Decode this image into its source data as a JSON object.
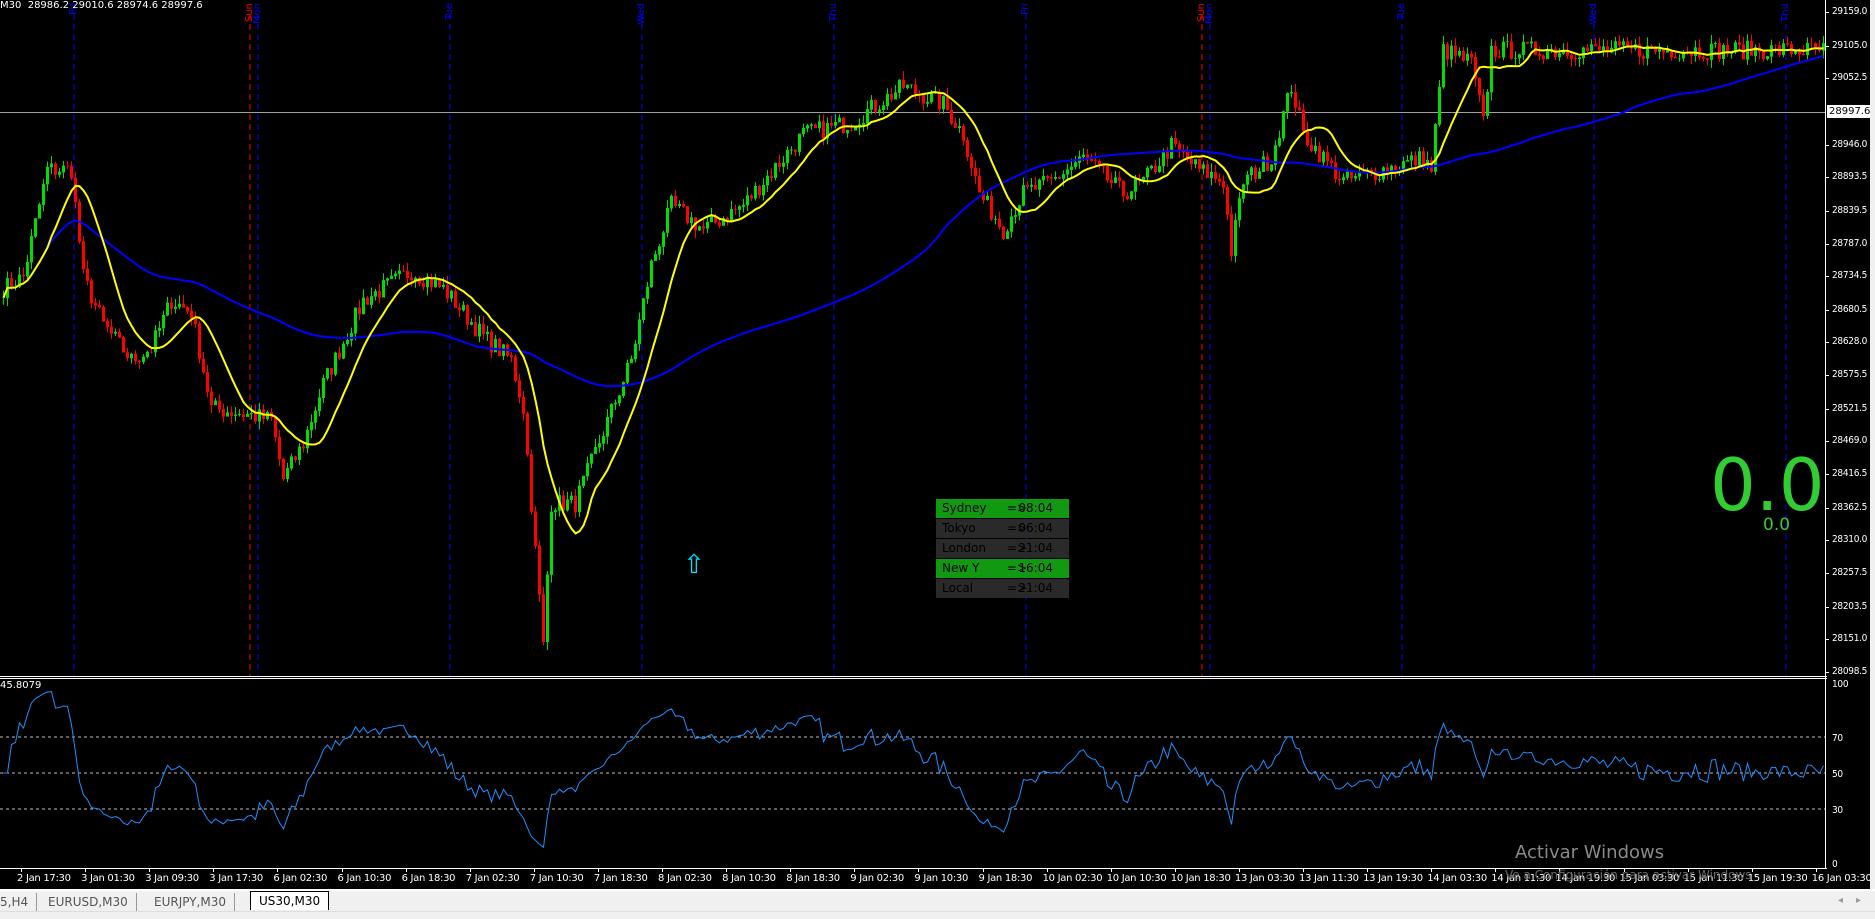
{
  "header": {
    "text": "M30  28986.2 29010.6 28974.6 28997.6"
  },
  "price_axis": {
    "labels": [
      "29159.0",
      "29105.0",
      "29052.5",
      "28946.0",
      "28893.5",
      "28839.5",
      "28787.0",
      "28734.5",
      "28680.5",
      "28628.0",
      "28575.5",
      "28521.5",
      "28469.0",
      "28416.5",
      "28362.5",
      "28310.0",
      "28257.5",
      "28203.5",
      "28151.0",
      "28098.5"
    ],
    "current_price": "28997.6",
    "range": [
      28098.5,
      29159.0
    ]
  },
  "rsi": {
    "value_label": "45.8079",
    "levels": [
      "100",
      "70",
      "50",
      "30",
      "0"
    ]
  },
  "day_markers": [
    {
      "label": "Fri",
      "color": "#0000ff",
      "bar": 18
    },
    {
      "label": "Sun",
      "color": "#ff0000",
      "bar": 62
    },
    {
      "label": "Mon",
      "color": "#0000ff",
      "bar": 64
    },
    {
      "label": "Tue",
      "color": "#0000ff",
      "bar": 112
    },
    {
      "label": "Wed",
      "color": "#0000ff",
      "bar": 160
    },
    {
      "label": "Thu",
      "color": "#0000ff",
      "bar": 208
    },
    {
      "label": "Fri",
      "color": "#0000ff",
      "bar": 256
    },
    {
      "label": "Sun",
      "color": "#ff0000",
      "bar": 300
    },
    {
      "label": "Mon",
      "color": "#0000ff",
      "bar": 302
    },
    {
      "label": "Tue",
      "color": "#0000ff",
      "bar": 350
    },
    {
      "label": "Wed",
      "color": "#0000ff",
      "bar": 398
    },
    {
      "label": "Thu",
      "color": "#0000ff",
      "bar": 446
    }
  ],
  "time_axis": [
    "2 Jan 17:30",
    "3 Jan 01:30",
    "3 Jan 09:30",
    "3 Jan 17:30",
    "6 Jan 02:30",
    "6 Jan 10:30",
    "6 Jan 18:30",
    "7 Jan 02:30",
    "7 Jan 10:30",
    "7 Jan 18:30",
    "8 Jan 02:30",
    "8 Jan 10:30",
    "8 Jan 18:30",
    "9 Jan 02:30",
    "9 Jan 10:30",
    "9 Jan 18:30",
    "10 Jan 02:30",
    "10 Jan 10:30",
    "10 Jan 18:30",
    "13 Jan 03:30",
    "13 Jan 11:30",
    "13 Jan 19:30",
    "14 Jan 03:30",
    "14 Jan 11:30",
    "14 Jan 19:30",
    "15 Jan 03:30",
    "15 Jan 11:30",
    "15 Jan 19:30",
    "16 Jan 03:30"
  ],
  "sessions": [
    {
      "name": "Sydney",
      "arrow": "=>",
      "time": "08:04",
      "color": "#119a11"
    },
    {
      "name": "Tokyo",
      "arrow": "=>",
      "time": "06:04",
      "color": "#2a2a2a"
    },
    {
      "name": "London",
      "arrow": "=>",
      "time": "21:04",
      "color": "#2a2a2a"
    },
    {
      "name": "New Y",
      "arrow": "=>",
      "time": "16:04",
      "color": "#119a11"
    },
    {
      "name": "Local",
      "arrow": "=>",
      "time": "21:04",
      "color": "#2a2a2a"
    }
  ],
  "spread": {
    "big": "0.0",
    "small": "0.0"
  },
  "signal_arrow": "⇧",
  "watermark": {
    "line1": "Activar Windows",
    "line2": "Ve a Configuración para activar Windows"
  },
  "tabs": [
    {
      "label": "5,H4",
      "active": false
    },
    {
      "label": "EURUSD,M30",
      "active": false
    },
    {
      "label": "EURJPY,M30",
      "active": false
    },
    {
      "label": "US30,M30",
      "active": true
    }
  ],
  "colors": {
    "bull": "#00dd00",
    "bear": "#ff0000",
    "ma_fast": "#ffff00",
    "ma_slow": "#0000ff",
    "rsi": "#1e90ff"
  },
  "chart_data": {
    "type": "candlestick",
    "symbol": "US30",
    "timeframe": "M30",
    "bars": 456,
    "price_path": [
      [
        0,
        28715
      ],
      [
        5,
        28734
      ],
      [
        11,
        28906
      ],
      [
        17,
        28906
      ],
      [
        20,
        28734
      ],
      [
        25,
        28657
      ],
      [
        32,
        28600
      ],
      [
        37,
        28619
      ],
      [
        42,
        28696
      ],
      [
        47,
        28677
      ],
      [
        52,
        28523
      ],
      [
        60,
        28514
      ],
      [
        67,
        28504
      ],
      [
        70,
        28409
      ],
      [
        75,
        28466
      ],
      [
        80,
        28562
      ],
      [
        90,
        28696
      ],
      [
        102,
        28743
      ],
      [
        110,
        28715
      ],
      [
        120,
        28638
      ],
      [
        127,
        28600
      ],
      [
        130,
        28523
      ],
      [
        132,
        28370
      ],
      [
        135,
        28141
      ],
      [
        137,
        28370
      ],
      [
        143,
        28370
      ],
      [
        150,
        28485
      ],
      [
        157,
        28600
      ],
      [
        162,
        28753
      ],
      [
        167,
        28849
      ],
      [
        175,
        28810
      ],
      [
        185,
        28849
      ],
      [
        190,
        28887
      ],
      [
        200,
        28963
      ],
      [
        212,
        28982
      ],
      [
        225,
        29040
      ],
      [
        235,
        29011
      ],
      [
        240,
        28963
      ],
      [
        244,
        28868
      ],
      [
        250,
        28810
      ],
      [
        255,
        28868
      ],
      [
        262,
        28887
      ],
      [
        270,
        28925
      ],
      [
        275,
        28897
      ],
      [
        280,
        28868
      ],
      [
        285,
        28887
      ],
      [
        292,
        28944
      ],
      [
        299,
        28906
      ],
      [
        305,
        28887
      ],
      [
        307,
        28776
      ],
      [
        310,
        28887
      ],
      [
        317,
        28925
      ],
      [
        322,
        29040
      ],
      [
        325,
        28963
      ],
      [
        330,
        28925
      ],
      [
        335,
        28887
      ],
      [
        345,
        28906
      ],
      [
        355,
        28925
      ],
      [
        357,
        28906
      ],
      [
        360,
        29098
      ],
      [
        367,
        29078
      ],
      [
        370,
        28982
      ],
      [
        372,
        29098
      ],
      [
        381,
        29098
      ],
      [
        455,
        29098
      ]
    ]
  }
}
